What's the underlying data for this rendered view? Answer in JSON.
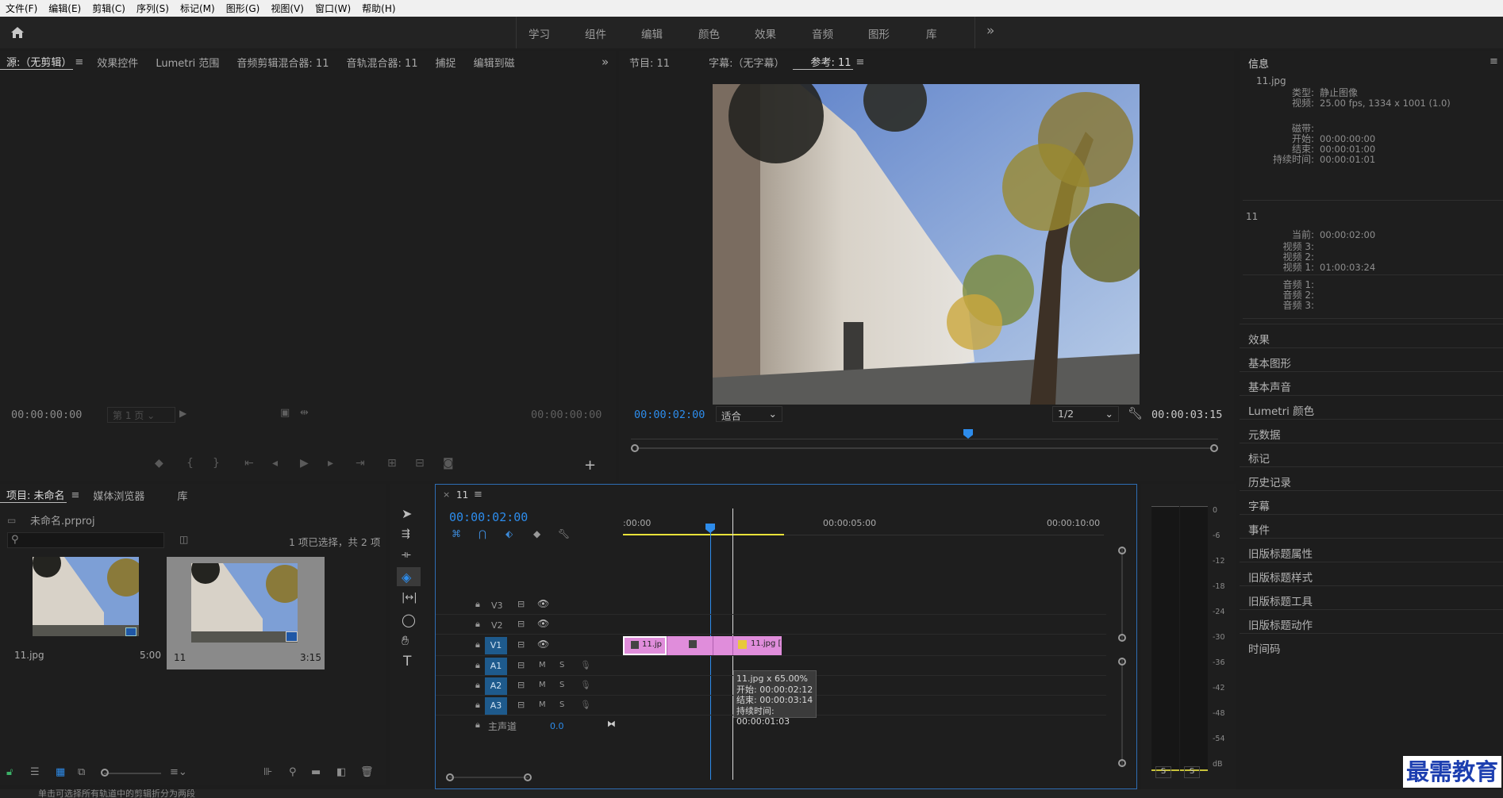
{
  "menu": [
    "文件(F)",
    "编辑(E)",
    "剪辑(C)",
    "序列(S)",
    "标记(M)",
    "图形(G)",
    "视图(V)",
    "窗口(W)",
    "帮助(H)"
  ],
  "workspaces": [
    "学习",
    "组件",
    "编辑",
    "颜色",
    "效果",
    "音频",
    "图形",
    "库"
  ],
  "source_tabs": {
    "source": "源:（无剪辑）",
    "effect_controls": "效果控件",
    "lumetri_scope": "Lumetri 范围",
    "audio_clip_mixer": "音频剪辑混合器: 11",
    "audio_track_mixer": "音轨混合器: 11",
    "capture": "捕捉",
    "edit_to": "编辑到磁"
  },
  "source": {
    "tc_left": "00:00:00:00",
    "page": "第 1 页",
    "tc_right": "00:00:00:00"
  },
  "program_tabs": {
    "program": "节目: 11",
    "captions": "字幕:（无字幕）",
    "reference": "参考: 11"
  },
  "program": {
    "tc_left": "00:00:02:00",
    "fit": "适合",
    "res": "1/2",
    "tc_right": "00:00:03:15"
  },
  "project_tabs": {
    "project": "项目: 未命名",
    "media_browser": "媒体浏览器",
    "library": "库"
  },
  "project": {
    "file": "未命名.prproj",
    "selection": "1 项已选择，共 2 项",
    "search_placeholder": "",
    "items": [
      {
        "name": "11.jpg",
        "duration": "5:00"
      },
      {
        "name": "11",
        "duration": "3:15"
      }
    ]
  },
  "timeline": {
    "tab": "11",
    "tc": "00:00:02:00",
    "ruler": [
      ":00:00",
      "00:00:05:00",
      "00:00:10:00"
    ],
    "video_tracks": [
      "V3",
      "V2",
      "V1"
    ],
    "audio_tracks": [
      "A1",
      "A2",
      "A3"
    ],
    "master": "主声道",
    "master_val": "0.0",
    "clips": [
      "11.jp",
      "11.jpg ["
    ],
    "tooltip": {
      "line1": "11.jpg x 65.00%",
      "line2": "开始: 00:00:02:12",
      "line3": "结束: 00:00:03:14",
      "line4": "持续时间: 00:00:01:03"
    }
  },
  "meters": {
    "scale": [
      "0",
      "-6",
      "-12",
      "-18",
      "-24",
      "-30",
      "-36",
      "-42",
      "-48",
      "-54",
      "dB"
    ],
    "solo": [
      "S",
      "S"
    ]
  },
  "info": {
    "title": "信息",
    "file": "11.jpg",
    "type_label": "类型:",
    "type_val": "静止图像",
    "video_label": "视频:",
    "video_val": "25.00 fps, 1334 x 1001 (1.0)",
    "tape_label": "磁带:",
    "start_label": "开始:",
    "start_val": "00:00:00:00",
    "end_label": "结束:",
    "end_val": "00:00:01:00",
    "dur_label": "持续时间:",
    "dur_val": "00:00:01:01",
    "seq": "11",
    "cur_label": "当前:",
    "cur_val": "00:00:02:00",
    "v3": "视频 3:",
    "v2": "视频 2:",
    "v1": "视频 1:",
    "v1_val": "01:00:03:24",
    "a1": "音频 1:",
    "a2": "音频 2:",
    "a3": "音频 3:"
  },
  "side_panels": [
    "效果",
    "基本图形",
    "基本声音",
    "Lumetri 颜色",
    "元数据",
    "标记",
    "历史记录",
    "字幕",
    "事件",
    "旧版标题属性",
    "旧版标题样式",
    "旧版标题工具",
    "旧版标题动作",
    "时间码"
  ],
  "status": "单击可选择所有轨道中的剪辑折分为两段",
  "watermark": "最需教育",
  "colors": {
    "accent": "#2d8ceb",
    "clip": "#e08ddb",
    "work_area": "#e8e23a"
  }
}
